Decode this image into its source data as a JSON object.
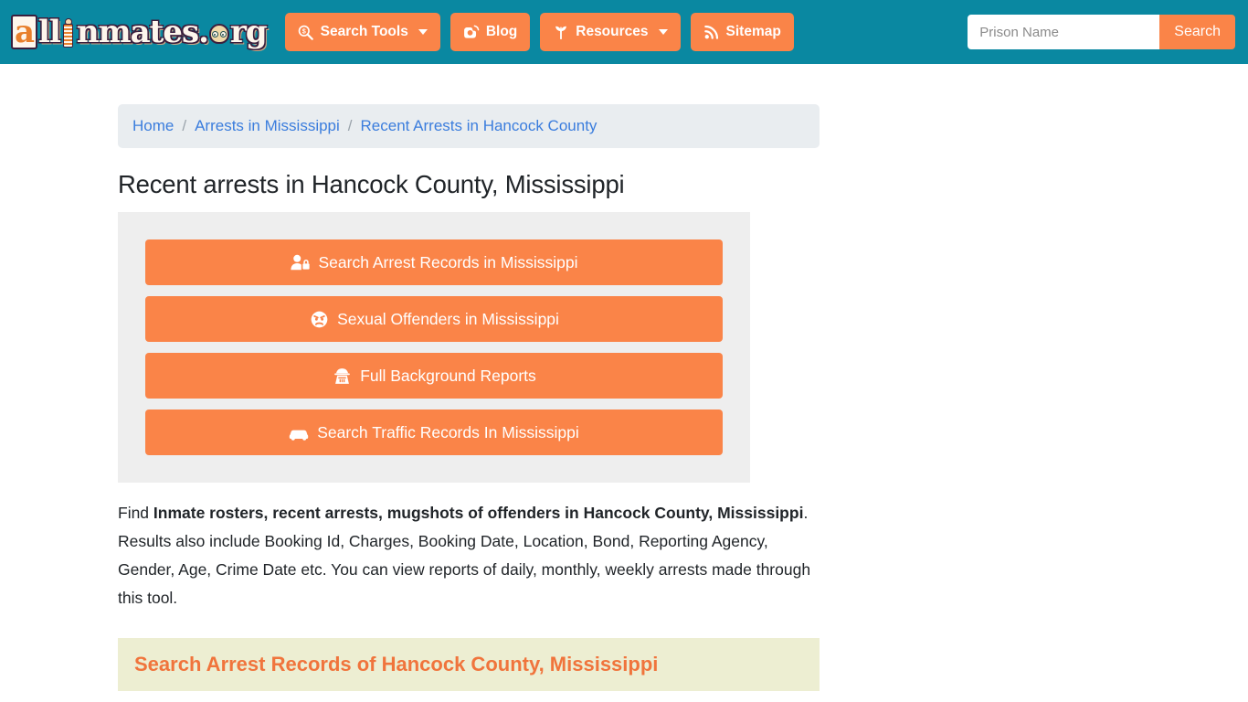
{
  "colors": {
    "header_teal": "#0a88a1",
    "accent_orange": "#fa8448",
    "panel_gray": "#eeeeee",
    "breadcrumb_gray": "#e9edf0",
    "link_blue": "#3b7ddd",
    "banner_bg": "#edeed2",
    "banner_text": "#f0743c"
  },
  "header": {
    "logo": {
      "text_all": "all",
      "text_inmates": "nmates",
      "text_dotorg": ".",
      "text_rg": "rg",
      "full_text": "allinmates.org",
      "figure_icon": "inmate-figure-icon",
      "face_icon": "prisoner-face-icon"
    },
    "nav": [
      {
        "label": "Search Tools",
        "icon": "search-dollar-icon",
        "has_caret": true
      },
      {
        "label": "Blog",
        "icon": "blogger-b-icon",
        "has_caret": false
      },
      {
        "label": "Resources",
        "icon": "seedling-icon",
        "has_caret": true
      },
      {
        "label": "Sitemap",
        "icon": "rss-feed-icon",
        "has_caret": false
      }
    ],
    "search": {
      "placeholder": "Prison Name",
      "value": "",
      "button_label": "Search"
    }
  },
  "breadcrumb": {
    "items": [
      {
        "label": "Home"
      },
      {
        "label": "Arrests in Mississippi"
      },
      {
        "label": "Recent Arrests in Hancock County"
      }
    ],
    "separator": "/"
  },
  "main": {
    "page_title": "Recent arrests in Hancock County, Mississippi",
    "cta_buttons": [
      {
        "label": "Search Arrest Records in Mississippi",
        "icon": "user-lock-icon"
      },
      {
        "label": "Sexual Offenders in Mississippi",
        "icon": "angry-face-icon"
      },
      {
        "label": "Full Background Reports",
        "icon": "user-secret-icon"
      },
      {
        "label": "Search Traffic Records In Mississippi",
        "icon": "car-icon"
      }
    ],
    "intro": {
      "lead": "Find ",
      "bold": "Inmate rosters, recent arrests, mugshots of offenders in Hancock County, Mississippi",
      "rest": ". Results also include Booking Id, Charges, Booking Date, Location, Bond, Reporting Agency, Gender, Age, Crime Date etc. You can view reports of daily, monthly, weekly arrests made through this tool."
    },
    "section_banner_title": "Search Arrest Records of Hancock County, Mississippi"
  }
}
